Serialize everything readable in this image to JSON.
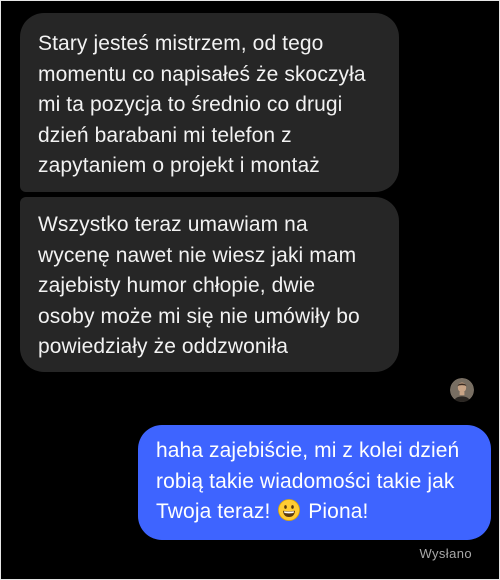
{
  "messages": [
    {
      "direction": "incoming",
      "text": "Stary jesteś mistrzem, od tego\nmomentu co napisałeś że skoczyła\nmi ta pozycja to średnio co drugi\ndzień barabani mi telefon z\nzapytaniem o projekt i montaż"
    },
    {
      "direction": "incoming",
      "text": "Wszystko teraz umawiam na\nwycenę nawet nie wiesz jaki mam\nzajebisty humor chłopie, dwie\nosoby może mi się nie umówiły bo\npowiedziały że oddzwoniła"
    },
    {
      "direction": "outgoing",
      "text_before_emoji": "haha zajebiście, mi z kolei dzień\nrobią takie wiadomości takie jak\nTwoja teraz!",
      "emoji": "grinning-face-emoji",
      "text_after_emoji": "Piona!"
    }
  ],
  "status": "Wysłano",
  "colors": {
    "background": "#000000",
    "incoming_bubble": "#262626",
    "outgoing_bubble": "#3e64ff",
    "status_text": "#a8a8a8"
  },
  "icons": {
    "seen_avatar": "avatar"
  }
}
